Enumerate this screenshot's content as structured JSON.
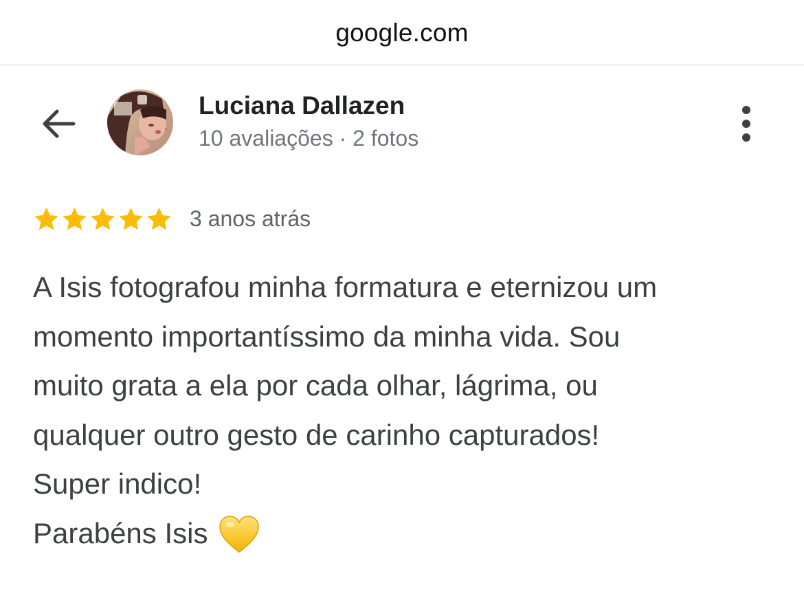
{
  "browser": {
    "url": "google.com"
  },
  "header": {
    "back_icon": "arrow-left-icon",
    "reviewer_name": "Luciana Dallazen",
    "reviewer_meta": "10 avaliações · 2 fotos",
    "more_icon": "more-vert-icon"
  },
  "review": {
    "rating": 5,
    "rating_max": 5,
    "star_color": "#fbbc04",
    "date": "3 anos atrás",
    "body": "A Isis fotografou minha formatura e eternizou um\nmomento importantíssimo da minha vida. Sou\nmuito grata a ela por cada olhar, lágrima, ou\nqualquer outro gesto de carinho capturados!\nSuper indico!",
    "closing": "Parabéns Isis",
    "closing_icon": "yellow-heart-icon"
  }
}
